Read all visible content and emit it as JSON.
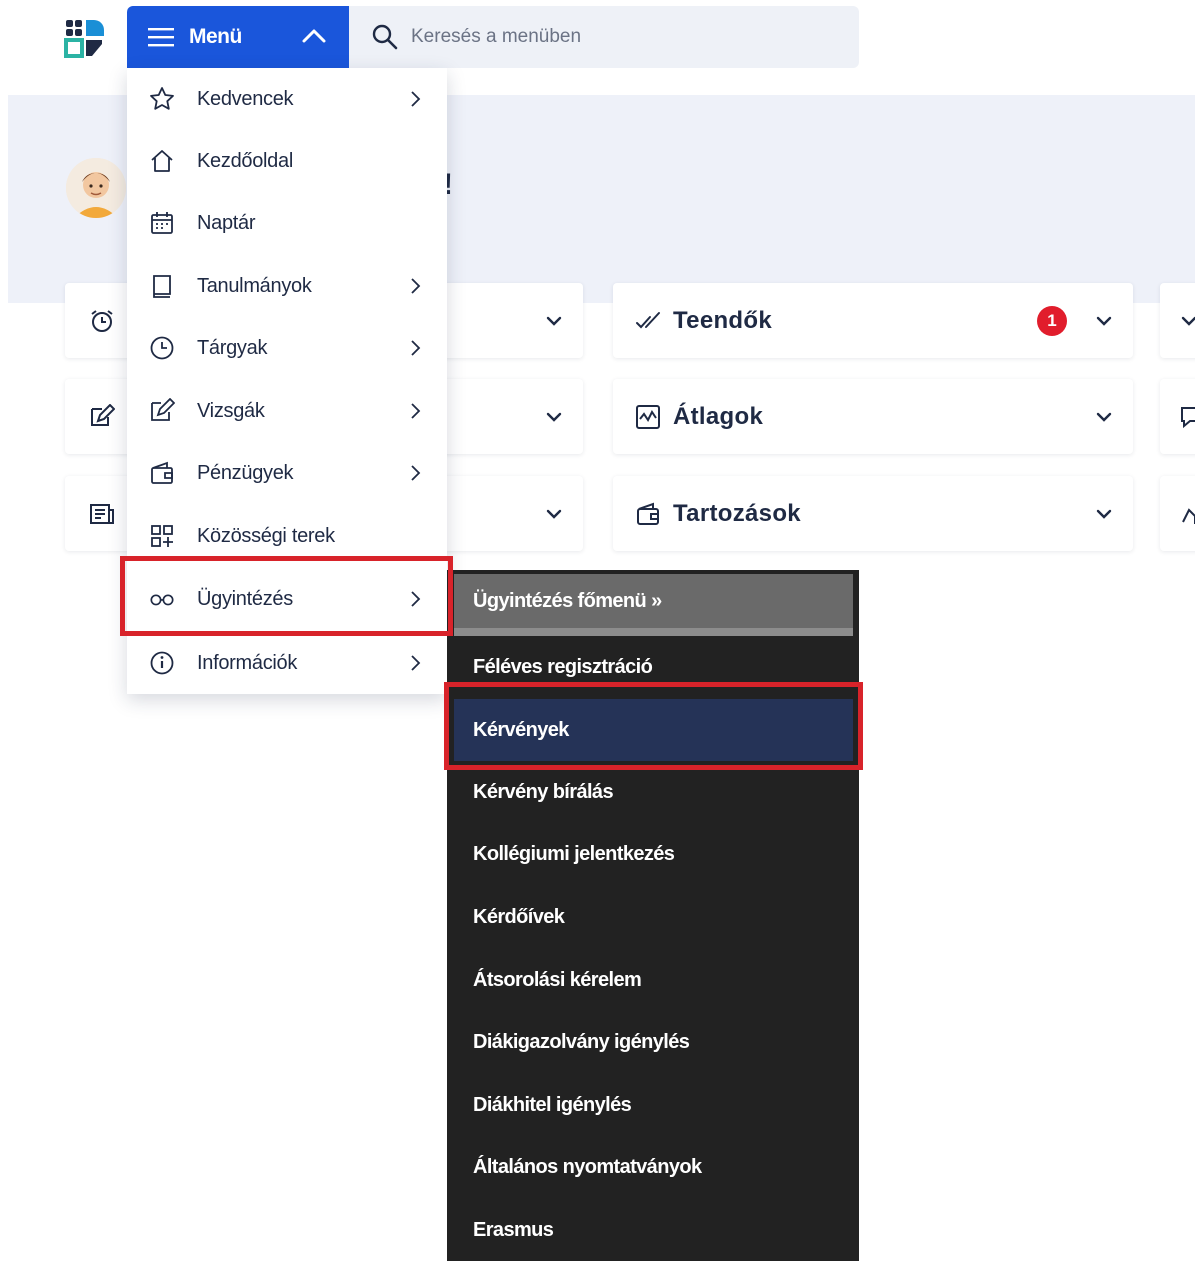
{
  "topbar": {
    "menu_label": "Menü",
    "search_placeholder": "Keresés a menüben"
  },
  "hero": {
    "greeting_tail": "!"
  },
  "cards": {
    "left": [
      {
        "label": "",
        "icon": "alarm-clock-icon"
      },
      {
        "label": "",
        "icon": "edit-icon"
      },
      {
        "label": "",
        "icon": "news-icon"
      }
    ],
    "middle": [
      {
        "label": "Teendők",
        "icon": "checkmarks-icon",
        "badge": "1"
      },
      {
        "label": "Átlagok",
        "icon": "chart-icon"
      },
      {
        "label": "Tartozások",
        "icon": "wallet-icon"
      }
    ]
  },
  "menu": {
    "items": [
      {
        "label": "Kedvencek",
        "icon": "star-icon",
        "submenu": true
      },
      {
        "label": "Kezdőoldal",
        "icon": "home-icon",
        "submenu": false
      },
      {
        "label": "Naptár",
        "icon": "calendar-icon",
        "submenu": false
      },
      {
        "label": "Tanulmányok",
        "icon": "book-icon",
        "submenu": true
      },
      {
        "label": "Tárgyak",
        "icon": "clock-icon",
        "submenu": true
      },
      {
        "label": "Vizsgák",
        "icon": "exam-edit-icon",
        "submenu": true
      },
      {
        "label": "Pénzügyek",
        "icon": "wallet-icon",
        "submenu": true
      },
      {
        "label": "Közösségi terek",
        "icon": "grid-plus-icon",
        "submenu": false
      },
      {
        "label": "Ügyintézés",
        "icon": "glasses-icon",
        "submenu": true,
        "highlighted": true
      },
      {
        "label": "Információk",
        "icon": "info-icon",
        "submenu": true
      }
    ]
  },
  "submenu": {
    "header": "Ügyintézés főmenü »",
    "items": [
      {
        "label": "Féléves regisztráció"
      },
      {
        "label": "Kérvények",
        "active": true
      },
      {
        "label": "Kérvény bírálás"
      },
      {
        "label": "Kollégiumi jelentkezés"
      },
      {
        "label": "Kérdőívek"
      },
      {
        "label": "Átsorolási kérelem"
      },
      {
        "label": "Diákigazolvány igénylés"
      },
      {
        "label": "Diákhitel igénylés"
      },
      {
        "label": "Általános nyomtatványok"
      },
      {
        "label": "Erasmus"
      }
    ]
  },
  "colors": {
    "brand_blue": "#1a56db",
    "badge_red": "#e11d2c",
    "highlight_red": "#d8232a",
    "submenu_bg": "#222222",
    "submenu_active": "#253357"
  }
}
